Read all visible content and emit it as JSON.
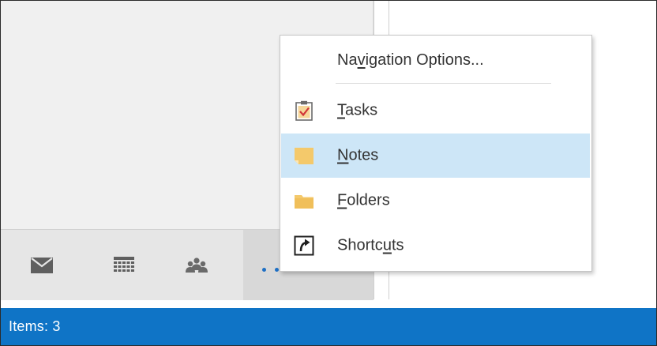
{
  "menu": {
    "header": {
      "before": "Na",
      "mnemonic": "v",
      "after": "igation Options..."
    },
    "items": [
      {
        "id": "tasks",
        "before": "",
        "mnemonic": "T",
        "after": "asks",
        "icon": "tasks-clipboard-icon",
        "highlighted": false
      },
      {
        "id": "notes",
        "before": "",
        "mnemonic": "N",
        "after": "otes",
        "icon": "sticky-note-icon",
        "highlighted": true
      },
      {
        "id": "folders",
        "before": "",
        "mnemonic": "F",
        "after": "olders",
        "icon": "folder-icon",
        "highlighted": false
      },
      {
        "id": "shortcuts",
        "before": "Shortc",
        "mnemonic": "u",
        "after": "ts",
        "icon": "shortcut-arrow-icon",
        "highlighted": false
      }
    ]
  },
  "navigation": {
    "buttons": [
      {
        "id": "mail",
        "icon": "mail-icon"
      },
      {
        "id": "calendar",
        "icon": "calendar-icon"
      },
      {
        "id": "people",
        "icon": "people-icon"
      },
      {
        "id": "more",
        "icon": "more-dots-icon"
      }
    ]
  },
  "status_bar": {
    "items_text": "Items: 3"
  },
  "colors": {
    "status_bar": "#0f74c6",
    "menu_highlight": "#cde6f7",
    "nav_bar": "#e6e6e6",
    "dots_accent": "#1e6fc4",
    "note_yellow": "#f4c96b"
  }
}
